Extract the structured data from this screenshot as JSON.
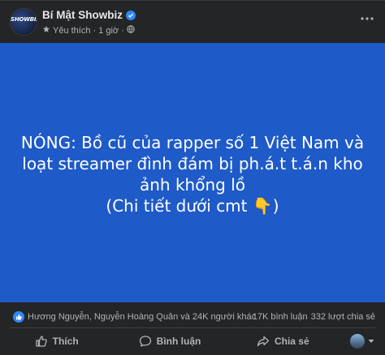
{
  "post": {
    "page_name": "Bí Mật Showbiz",
    "avatar_text": "SHOWBIZ",
    "meta_label": "Yêu thích",
    "meta_separator": "·",
    "time": "1 giờ",
    "more_icon": "more-horizontal-icon"
  },
  "banner": {
    "background_color": "#1e5ac8",
    "lines": [
      "NÓNG: Bồ cũ của rapper số 1 Việt Nam và",
      "loạt streamer đình đám bị ph.á.t t.á.n kho",
      "ảnh khổng lồ",
      "(Chi tiết dưới cmt 👇)"
    ]
  },
  "stats": {
    "reactors": "Hương Nguyễn, Nguyễn Hoàng Quân và 24K người khác",
    "comments": "17K bình luận",
    "shares": "332 lượt chia sẻ"
  },
  "actions": {
    "like": "Thích",
    "comment": "Bình luận",
    "share": "Chia sẻ"
  },
  "colors": {
    "card": "#242526",
    "accent": "#2d88ff",
    "muted_text": "#b0b3b8"
  }
}
